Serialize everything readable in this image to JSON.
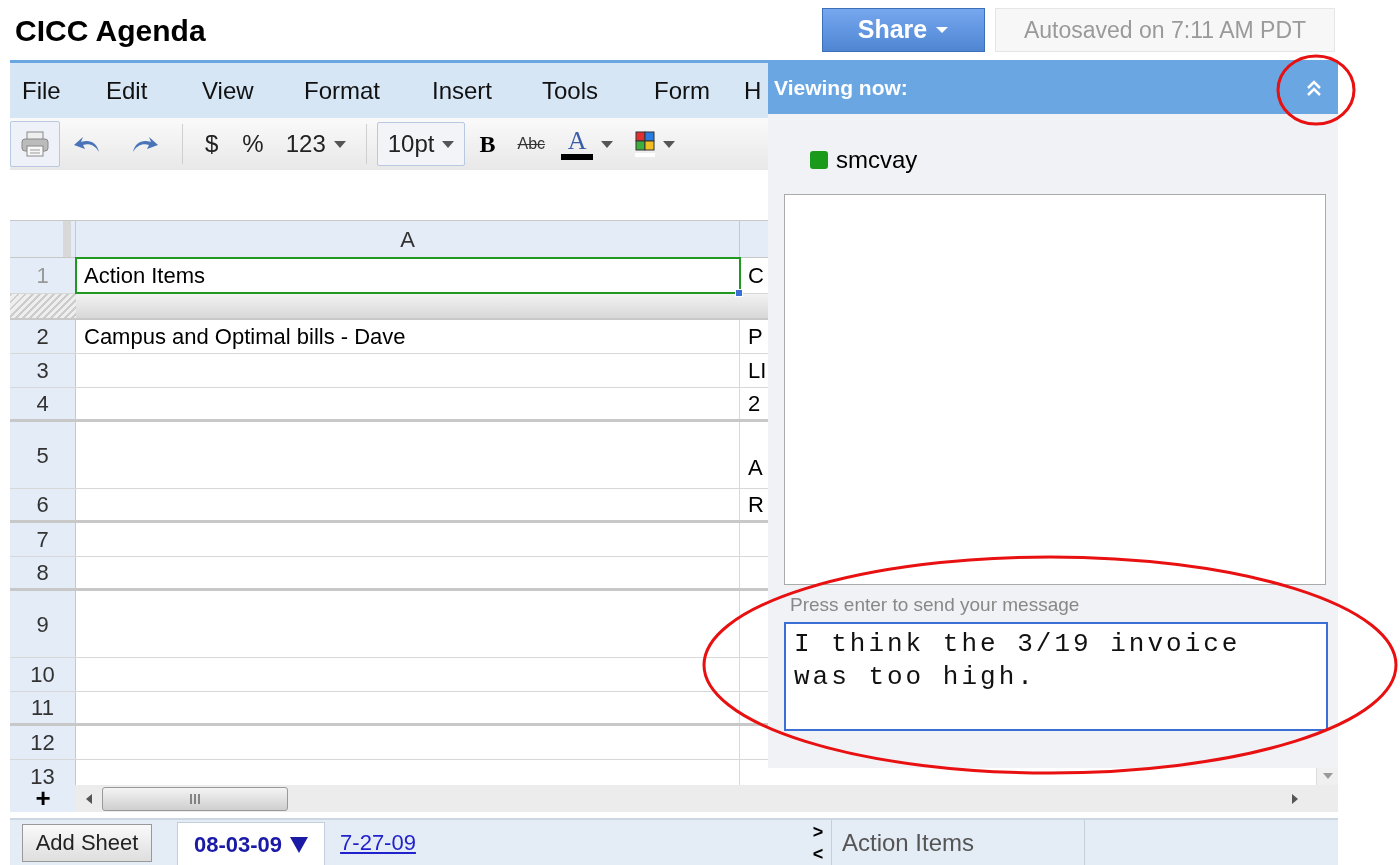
{
  "title": "CICC Agenda",
  "share_button": {
    "label": "Share"
  },
  "autosave": "Autosaved on 7:11 AM PDT",
  "menu": [
    "File",
    "Edit",
    "View",
    "Format",
    "Insert",
    "Tools",
    "Form",
    "H"
  ],
  "toolbar": [
    {
      "kind": "print",
      "boxed": true
    },
    {
      "kind": "undo"
    },
    {
      "kind": "redo"
    },
    {
      "kind": "separator"
    },
    {
      "kind": "text",
      "label": "$"
    },
    {
      "kind": "text",
      "label": "%"
    },
    {
      "kind": "dropdown",
      "label": "123",
      "boxed": false
    },
    {
      "kind": "separator"
    },
    {
      "kind": "dropdown",
      "label": "10pt",
      "boxed": true
    },
    {
      "kind": "bold",
      "label": "B"
    },
    {
      "kind": "strike",
      "label": "Abc"
    },
    {
      "kind": "text_color",
      "label": "A"
    },
    {
      "kind": "fill_color"
    }
  ],
  "columns": [
    {
      "label": "A"
    }
  ],
  "rows": [
    {
      "number": "1",
      "tall": false,
      "cells": [
        {
          "text": "Action Items",
          "selected": true
        },
        {
          "text": "C",
          "selected": false
        }
      ]
    },
    {
      "number": "2",
      "tall": false,
      "cells": [
        {
          "text": "Campus and Optimal bills - Dave",
          "selected": false
        },
        {
          "text": "P",
          "selected": false
        }
      ]
    },
    {
      "number": "3",
      "tall": false,
      "cells": [
        {
          "selected": false
        },
        {
          "text": "LI",
          "selected": false
        }
      ]
    },
    {
      "number": "4",
      "tall": false,
      "cells": [
        {
          "selected": false
        },
        {
          "text": "2",
          "selected": false
        }
      ]
    },
    {
      "number": "5",
      "tall": true,
      "cells": [
        {
          "selected": false
        },
        {
          "text": "A",
          "selected": false
        }
      ]
    },
    {
      "number": "6",
      "tall": false,
      "cells": [
        {
          "selected": false
        },
        {
          "text": "R",
          "selected": false
        }
      ]
    },
    {
      "number": "7",
      "tall": false,
      "cells": [
        {
          "selected": false
        },
        {
          "selected": false
        }
      ]
    },
    {
      "number": "8",
      "tall": false,
      "cells": [
        {
          "selected": false
        },
        {
          "selected": false
        }
      ]
    },
    {
      "number": "9",
      "tall": true,
      "cells": [
        {
          "selected": false
        },
        {
          "selected": false
        }
      ]
    },
    {
      "number": "10",
      "tall": false,
      "cells": [
        {
          "selected": false
        },
        {
          "selected": false
        }
      ]
    },
    {
      "number": "11",
      "tall": false,
      "cells": [
        {
          "selected": false
        },
        {
          "selected": false
        }
      ]
    },
    {
      "number": "12",
      "tall": false,
      "cells": [
        {
          "selected": false
        },
        {
          "selected": false
        }
      ]
    },
    {
      "number": "13",
      "tall": false,
      "cells": [
        {
          "selected": false
        },
        {
          "selected": false
        }
      ]
    }
  ],
  "add_rows": "+",
  "chat": {
    "header": "Viewing now:",
    "viewers": [
      {
        "name": "smcvay",
        "color": "#1a9a1a"
      }
    ],
    "hint": "Press enter to send your message",
    "message": "I think the 3/19 invoice was too high."
  },
  "add_sheet_button": "Add Sheet",
  "sheet_tabs": [
    {
      "label": "08-03-09",
      "selected": true
    },
    {
      "label": "7-27-09",
      "selected": false
    }
  ],
  "nav": [
    ">",
    "<"
  ],
  "status": "Action Items"
}
